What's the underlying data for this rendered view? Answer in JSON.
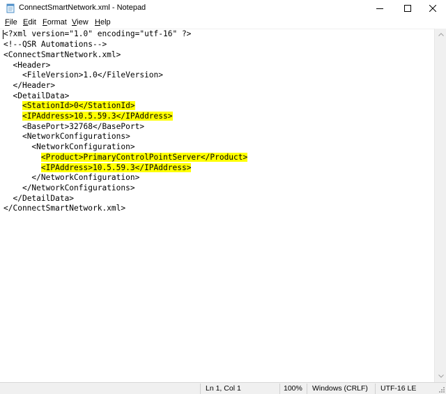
{
  "window": {
    "title": "ConnectSmartNetwork.xml - Notepad",
    "icon": "notepad-icon"
  },
  "menu": [
    {
      "label": "File",
      "accel": "F",
      "rest": "ile"
    },
    {
      "label": "Edit",
      "accel": "E",
      "rest": "dit"
    },
    {
      "label": "Format",
      "accel": "F",
      "rest": "ormat"
    },
    {
      "label": "View",
      "accel": "V",
      "rest": "iew"
    },
    {
      "label": "Help",
      "accel": "H",
      "rest": "elp"
    }
  ],
  "editor": {
    "lines": [
      {
        "text": "<?xml version=\"1.0\" encoding=\"utf-16\" ?>",
        "highlight": false
      },
      {
        "text": "<!--QSR Automations-->",
        "highlight": false
      },
      {
        "text": "<ConnectSmartNetwork.xml>",
        "highlight": false
      },
      {
        "indent": "  ",
        "text": "<Header>",
        "highlight": false
      },
      {
        "indent": "    ",
        "text": "<FileVersion>1.0</FileVersion>",
        "highlight": false
      },
      {
        "indent": "  ",
        "text": "</Header>",
        "highlight": false
      },
      {
        "indent": "  ",
        "text": "<DetailData>",
        "highlight": false
      },
      {
        "indent": "    ",
        "text": "<StationId>0</StationId>",
        "highlight": true
      },
      {
        "indent": "    ",
        "text": "<IPAddress>10.5.59.3</IPAddress>",
        "highlight": true
      },
      {
        "indent": "    ",
        "text": "<BasePort>32768</BasePort>",
        "highlight": false
      },
      {
        "indent": "    ",
        "text": "<NetworkConfigurations>",
        "highlight": false
      },
      {
        "indent": "      ",
        "text": "<NetworkConfiguration>",
        "highlight": false
      },
      {
        "indent": "        ",
        "text": "<Product>PrimaryControlPointServer</Product>",
        "highlight": true
      },
      {
        "indent": "        ",
        "text": "<IPAddress>10.5.59.3</IPAddress>",
        "highlight": true
      },
      {
        "indent": "      ",
        "text": "</NetworkConfiguration>",
        "highlight": false
      },
      {
        "indent": "    ",
        "text": "</NetworkConfigurations>",
        "highlight": false
      },
      {
        "indent": "  ",
        "text": "</DetailData>",
        "highlight": false
      },
      {
        "text": "</ConnectSmartNetwork.xml>",
        "highlight": false
      }
    ]
  },
  "status": {
    "position": "Ln 1, Col 1",
    "zoom": "100%",
    "line_ending": "Windows (CRLF)",
    "encoding": "UTF-16 LE"
  },
  "colors": {
    "highlight": "#ffff00",
    "statusbar": "#f0f0f0"
  }
}
